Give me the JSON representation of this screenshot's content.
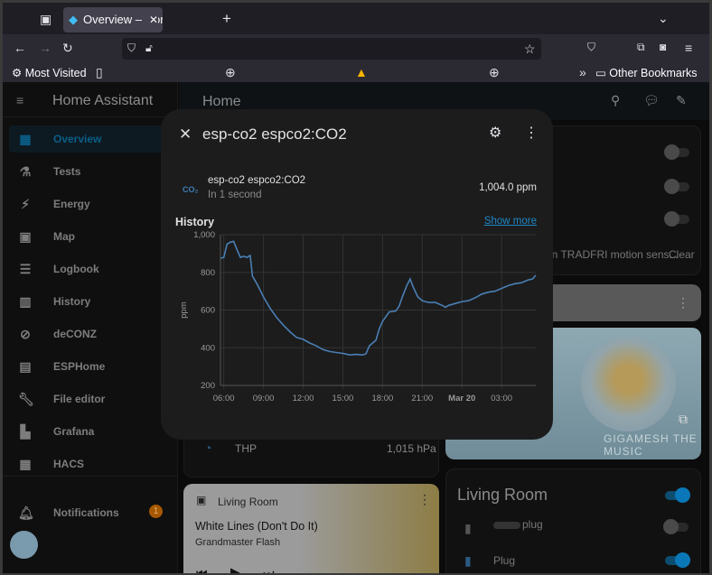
{
  "browser": {
    "tab_title": "Overview – Home Assistant",
    "new_tab": "+",
    "bookmarks": {
      "most_visited": "Most Visited",
      "other": "Other Bookmarks"
    }
  },
  "sidebar": {
    "title": "Home Assistant",
    "items": [
      {
        "label": "Overview",
        "icon": "dashboard-icon",
        "selected": true
      },
      {
        "label": "Tests",
        "icon": "test-tube-icon"
      },
      {
        "label": "Energy",
        "icon": "lightning-icon"
      },
      {
        "label": "Map",
        "icon": "map-account-icon"
      },
      {
        "label": "Logbook",
        "icon": "list-icon"
      },
      {
        "label": "History",
        "icon": "chart-box-icon"
      },
      {
        "label": "deCONZ",
        "icon": "zigbee-icon"
      },
      {
        "label": "ESPHome",
        "icon": "chip-icon"
      },
      {
        "label": "File editor",
        "icon": "wrench-icon"
      },
      {
        "label": "Grafana",
        "icon": "grafana-icon"
      },
      {
        "label": "HACS",
        "icon": "hacs-icon"
      }
    ],
    "notifications": {
      "label": "Notifications",
      "count": "1"
    }
  },
  "header": {
    "title": "Home"
  },
  "background": {
    "motion_text": "en TRADFRI motion sens...",
    "clear": "Clear",
    "thp_label": "THP",
    "thp_value": "1,015 hPa",
    "media": {
      "room": "Living Room",
      "track": "White Lines (Don't Do It)",
      "artist": "Grandmaster Flash",
      "art_text": "GIGAMESH THE MUSIC"
    },
    "living_room": {
      "title": "Living Room",
      "items": [
        {
          "label": "plug",
          "on": false
        },
        {
          "label": "Plug",
          "on": true
        }
      ]
    }
  },
  "dialog": {
    "title": "esp-co2 espco2:CO2",
    "entity_name": "esp-co2 espco2:CO2",
    "entity_icon": "CO₂",
    "last_changed": "In 1 second",
    "state": "1,004.0 ppm",
    "history_label": "History",
    "show_more": "Show more"
  },
  "colors": {
    "accent": "#03a9f4",
    "line": "#4a7fb5",
    "badge": "#c86a00"
  },
  "chart_data": {
    "type": "line",
    "ylabel": "ppm",
    "ylim": [
      200,
      1000
    ],
    "y_ticks": [
      "200",
      "400",
      "600",
      "800",
      "1,000"
    ],
    "grid": true,
    "x_ticks": [
      {
        "label": "06:00",
        "at": "Mar 19 06:00"
      },
      {
        "label": "09:00",
        "at": "Mar 19 09:00"
      },
      {
        "label": "12:00",
        "at": "Mar 19 12:00"
      },
      {
        "label": "15:00",
        "at": "Mar 19 15:00"
      },
      {
        "label": "18:00",
        "at": "Mar 19 18:00"
      },
      {
        "label": "21:00",
        "at": "Mar 19 21:00"
      },
      {
        "label": "Mar 20",
        "at": "Mar 20 00:00"
      },
      {
        "label": "03:00",
        "at": "Mar 20 03:00"
      }
    ],
    "xlim": [
      "Mar 19 05:45",
      "Mar 20 05:35"
    ],
    "points": [
      [
        "Mar 19 05:45",
        875
      ],
      [
        "Mar 19 06:00",
        880
      ],
      [
        "Mar 19 06:15",
        950
      ],
      [
        "Mar 19 06:30",
        960
      ],
      [
        "Mar 19 06:45",
        965
      ],
      [
        "Mar 19 07:00",
        920
      ],
      [
        "Mar 19 07:15",
        880
      ],
      [
        "Mar 19 07:30",
        885
      ],
      [
        "Mar 19 07:45",
        880
      ],
      [
        "Mar 19 08:00",
        890
      ],
      [
        "Mar 19 08:10",
        780
      ],
      [
        "Mar 19 08:30",
        740
      ],
      [
        "Mar 19 09:00",
        670
      ],
      [
        "Mar 19 09:30",
        610
      ],
      [
        "Mar 19 10:00",
        560
      ],
      [
        "Mar 19 10:30",
        520
      ],
      [
        "Mar 19 11:00",
        485
      ],
      [
        "Mar 19 11:30",
        455
      ],
      [
        "Mar 19 12:00",
        445
      ],
      [
        "Mar 19 12:30",
        425
      ],
      [
        "Mar 19 13:00",
        410
      ],
      [
        "Mar 19 13:30",
        390
      ],
      [
        "Mar 19 14:00",
        380
      ],
      [
        "Mar 19 14:30",
        375
      ],
      [
        "Mar 19 15:00",
        370
      ],
      [
        "Mar 19 15:30",
        362
      ],
      [
        "Mar 19 16:00",
        365
      ],
      [
        "Mar 19 16:30",
        362
      ],
      [
        "Mar 19 16:45",
        368
      ],
      [
        "Mar 19 17:00",
        410
      ],
      [
        "Mar 19 17:30",
        440
      ],
      [
        "Mar 19 17:45",
        500
      ],
      [
        "Mar 19 18:00",
        540
      ],
      [
        "Mar 19 18:30",
        590
      ],
      [
        "Mar 19 19:00",
        595
      ],
      [
        "Mar 19 19:15",
        620
      ],
      [
        "Mar 19 19:30",
        670
      ],
      [
        "Mar 19 19:50",
        730
      ],
      [
        "Mar 19 20:05",
        765
      ],
      [
        "Mar 19 20:20",
        720
      ],
      [
        "Mar 19 20:40",
        670
      ],
      [
        "Mar 19 21:00",
        650
      ],
      [
        "Mar 19 21:30",
        640
      ],
      [
        "Mar 19 22:00",
        640
      ],
      [
        "Mar 19 22:30",
        625
      ],
      [
        "Mar 19 22:45",
        615
      ],
      [
        "Mar 19 23:00",
        625
      ],
      [
        "Mar 19 23:30",
        635
      ],
      [
        "Mar 20 00:00",
        645
      ],
      [
        "Mar 20 00:30",
        650
      ],
      [
        "Mar 20 01:00",
        665
      ],
      [
        "Mar 20 01:30",
        685
      ],
      [
        "Mar 20 02:00",
        695
      ],
      [
        "Mar 20 02:30",
        700
      ],
      [
        "Mar 20 03:00",
        715
      ],
      [
        "Mar 20 03:30",
        730
      ],
      [
        "Mar 20 04:00",
        740
      ],
      [
        "Mar 20 04:30",
        745
      ],
      [
        "Mar 20 05:00",
        760
      ],
      [
        "Mar 20 05:20",
        765
      ],
      [
        "Mar 20 05:35",
        785
      ]
    ]
  }
}
